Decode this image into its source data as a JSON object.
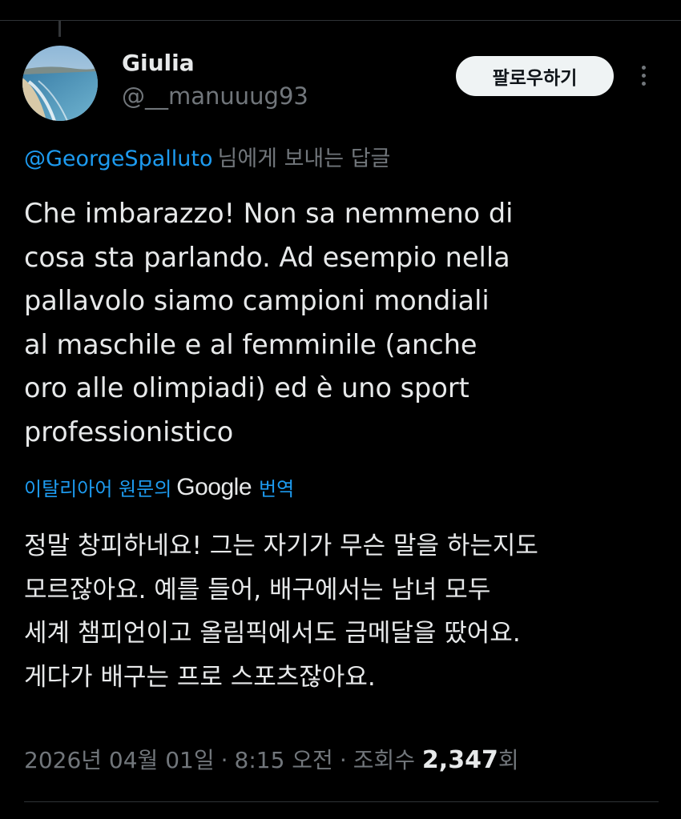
{
  "user": {
    "display_name": "Giulia",
    "handle": "@__manuuug93",
    "avatar_icon": "beach-photo-avatar"
  },
  "actions": {
    "follow_label": "팔로우하기",
    "more_icon": "more-vertical-icon"
  },
  "reply": {
    "mention": "@GeorgeSpalluto",
    "suffix": "님에게 보내는 답글"
  },
  "tweet": {
    "lines": [
      "Che imbarazzo! Non sa nemmeno di",
      "cosa sta parlando. Ad esempio nella",
      "pallavolo siamo campioni mondiali",
      "al maschile e al femminile (anche",
      "oro alle olimpiadi) ed è uno sport",
      "professionistico"
    ]
  },
  "translation": {
    "prefix": "이탈리아어 원문의",
    "provider": "Google",
    "suffix": "번역",
    "lines": [
      "정말 창피하네요! 그는 자기가 무슨 말을 하는지도",
      "모르잖아요. 예를 들어, 배구에서는 남녀 모두",
      "세계 챔피언이고 올림픽에서도 금메달을 땄어요.",
      "게다가 배구는 프로 스포츠잖아요."
    ]
  },
  "meta": {
    "date": "2026년 04월 01일",
    "time": "8:15 오전",
    "views_label": "조회수",
    "views_count": "2,347",
    "views_unit": "회"
  },
  "colors": {
    "background": "#000000",
    "text": "#e7e9ea",
    "muted": "#71767b",
    "accent": "#1d9bf0",
    "button_bg": "#eff3f4"
  }
}
